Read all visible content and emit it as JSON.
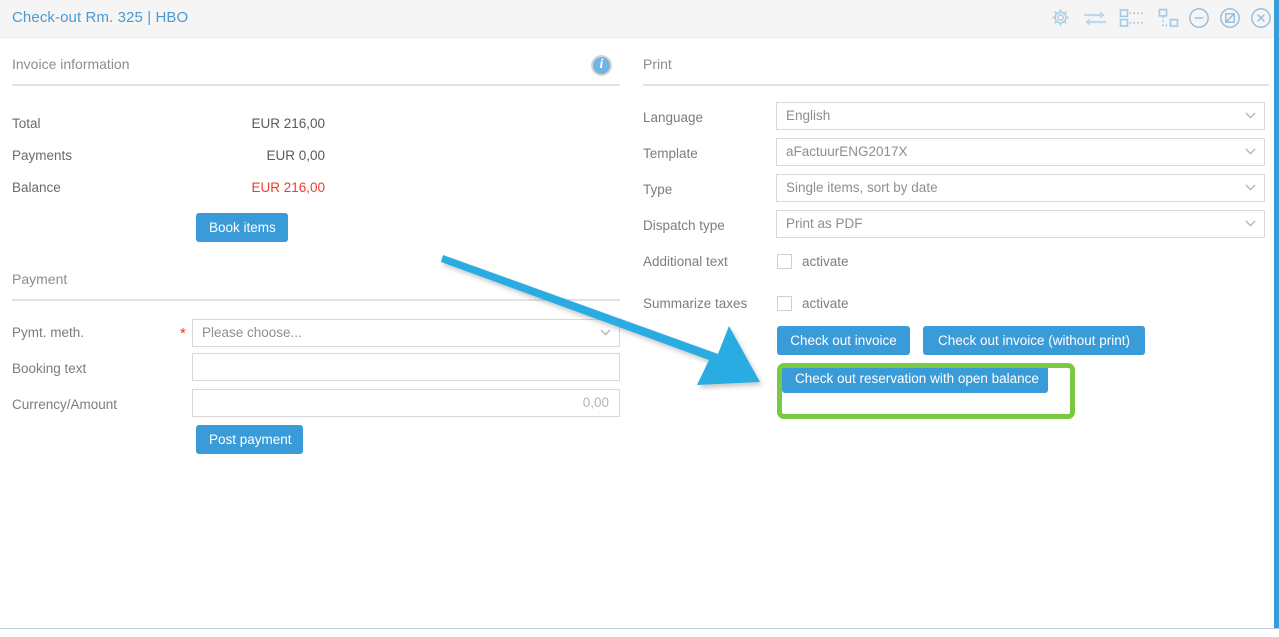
{
  "window": {
    "title": "Check-out Rm. 325 | HBO",
    "titlebar_icons_left": [
      "gear-icon",
      "transfer-arrows-icon",
      "align-list-icon",
      "resize-layout-icon"
    ],
    "titlebar_icons_right": [
      "minimize-icon",
      "restore-icon",
      "close-icon"
    ]
  },
  "invoice": {
    "section_title": "Invoice information",
    "info_icon": "info-icon",
    "rows": [
      {
        "label": "Total",
        "value": "EUR 216,00",
        "negative": false
      },
      {
        "label": "Payments",
        "value": "EUR 0,00",
        "negative": false
      },
      {
        "label": "Balance",
        "value": "EUR 216,00",
        "negative": true
      }
    ],
    "book_items_label": "Book items"
  },
  "payment": {
    "section_title": "Payment",
    "pymt_method_label": "Pymt. meth.",
    "pymt_method_required": "*",
    "pymt_method_value": "Please choose...",
    "booking_text_label": "Booking text",
    "booking_text_value": "",
    "currency_amount_label": "Currency/Amount",
    "currency_amount_value": "0,00",
    "post_payment_label": "Post payment"
  },
  "print": {
    "section_title": "Print",
    "language_label": "Language",
    "language_value": "English",
    "template_label": "Template",
    "template_value": "aFactuurENG2017X",
    "type_label": "Type",
    "type_value": "Single items, sort by date",
    "dispatch_type_label": "Dispatch type",
    "dispatch_type_value": "Print as PDF",
    "additional_text_label": "Additional text",
    "additional_text_checkbox_label": "activate",
    "additional_text_checked": false,
    "summarize_taxes_label": "Summarize taxes",
    "summarize_taxes_checkbox_label": "activate",
    "summarize_taxes_checked": false,
    "check_out_invoice_label": "Check out invoice",
    "check_out_invoice_no_print_label": "Check out invoice (without print)",
    "check_out_reservation_label": "Check out reservation with open balance"
  },
  "annotation": {
    "highlight_color": "#7ac943",
    "arrow_color": "#29abe2"
  },
  "colors": {
    "accent_blue": "#3a9bd9",
    "title_blue": "#4a9ad4",
    "negative_red": "#ef3b2d",
    "required_red": "#e8392c",
    "titlebar_bg": "#f5f5f5"
  }
}
